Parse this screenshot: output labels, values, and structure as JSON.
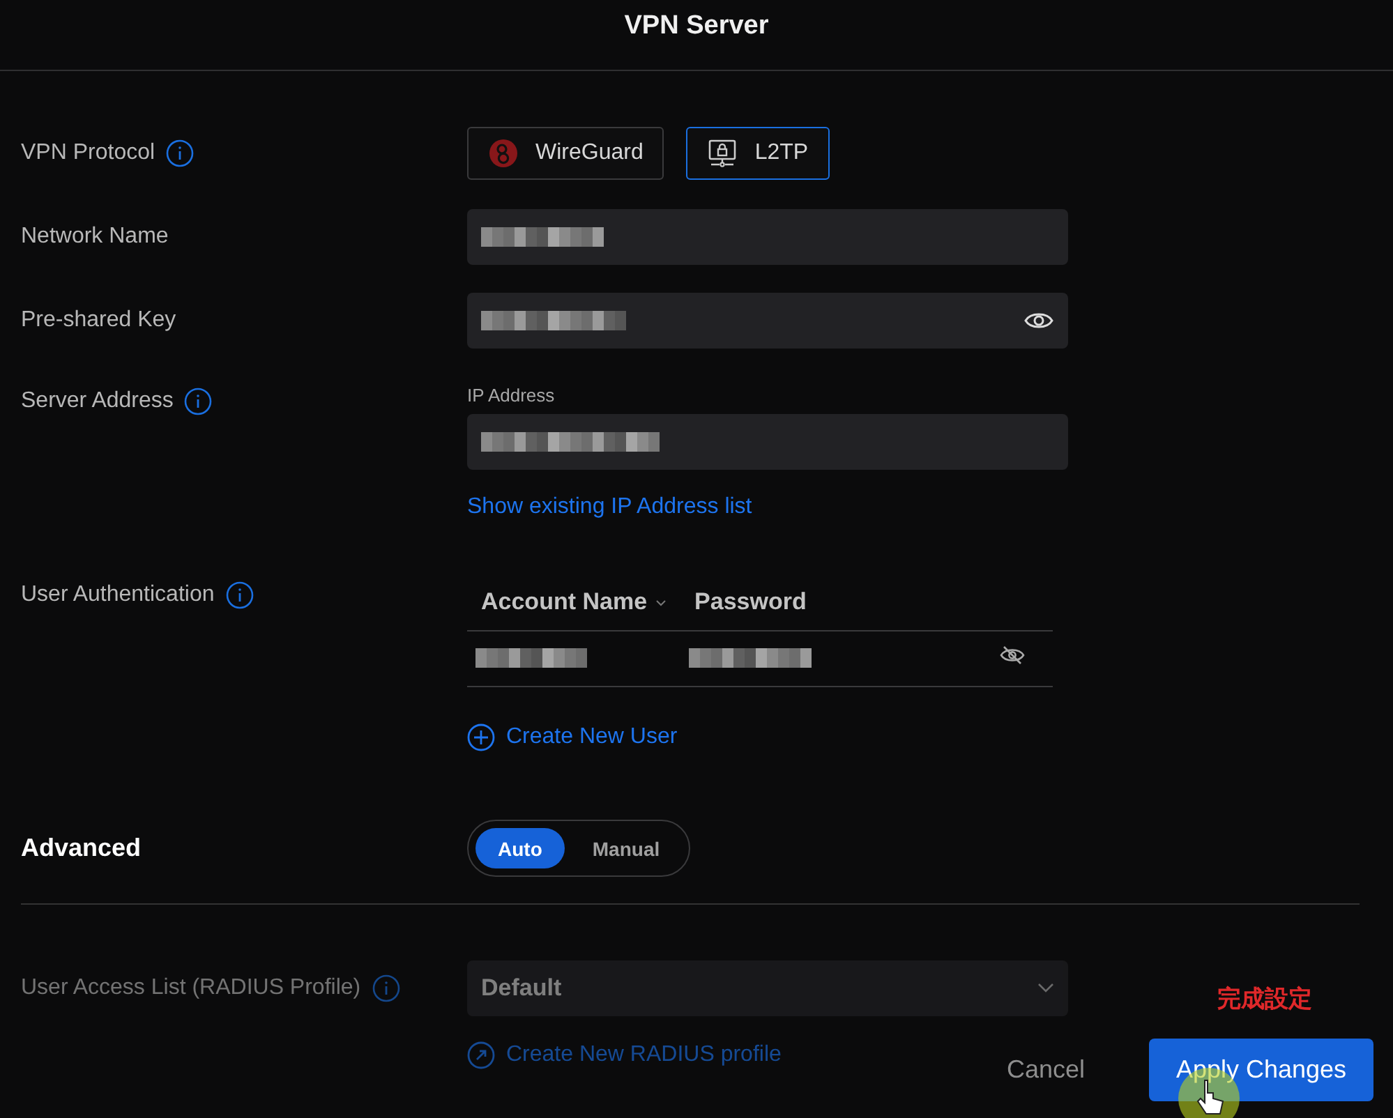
{
  "window": {
    "title": "VPN Server"
  },
  "vpn_protocol": {
    "label": "VPN Protocol",
    "options": [
      {
        "label": "WireGuard",
        "kind": "wireguard",
        "selected": false
      },
      {
        "label": "L2TP",
        "kind": "l2tp",
        "selected": true
      }
    ]
  },
  "network_name": {
    "label": "Network Name"
  },
  "pre_shared_key": {
    "label": "Pre-shared Key"
  },
  "server_address": {
    "label": "Server Address",
    "field_label": "IP Address",
    "link": "Show existing IP Address list"
  },
  "user_authentication": {
    "label": "User Authentication",
    "columns": [
      "Account Name",
      "Password"
    ],
    "create_link": "Create New User"
  },
  "advanced": {
    "label": "Advanced",
    "options": [
      {
        "label": "Auto",
        "selected": true
      },
      {
        "label": "Manual",
        "selected": false
      }
    ]
  },
  "user_access_list": {
    "label": "User Access List (RADIUS Profile)",
    "value": "Default",
    "link": "Create New RADIUS profile",
    "disabled": true
  },
  "annotation": "完成設定",
  "buttons": [
    {
      "label": "Cancel",
      "kind": "text"
    },
    {
      "label": "Apply Changes",
      "kind": "primary"
    }
  ]
}
